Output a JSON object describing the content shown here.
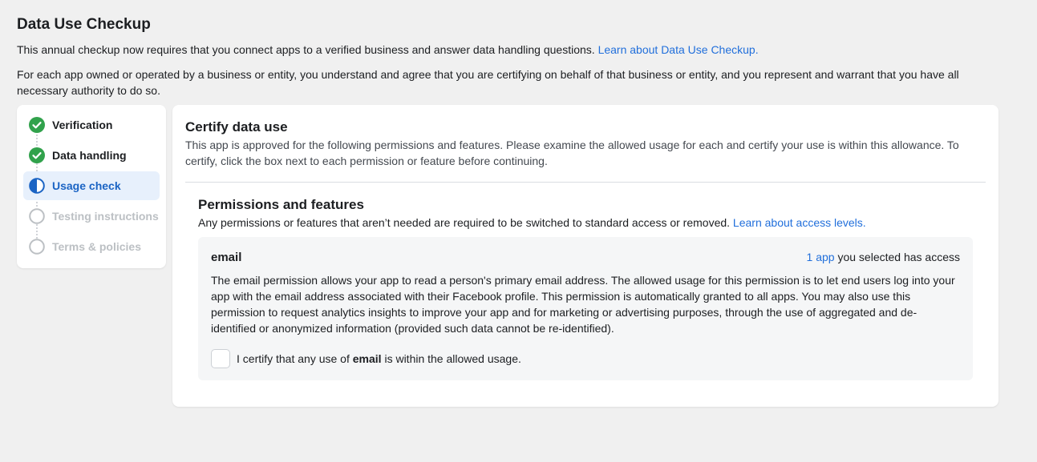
{
  "header": {
    "title": "Data Use Checkup",
    "intro": "This annual checkup now requires that you connect apps to a verified business and answer data handling questions.",
    "intro_link": "Learn about Data Use Checkup.",
    "authority": "For each app owned or operated by a business or entity, you understand and agree that you are certifying on behalf of that business or entity, and you represent and warrant that you have all necessary authority to do so."
  },
  "stepper": {
    "steps": [
      {
        "label": "Verification",
        "state": "done"
      },
      {
        "label": "Data handling",
        "state": "done"
      },
      {
        "label": "Usage check",
        "state": "current"
      },
      {
        "label": "Testing instructions",
        "state": "pending"
      },
      {
        "label": "Terms & policies",
        "state": "pending"
      }
    ]
  },
  "certify": {
    "title": "Certify data use",
    "description": "This app is approved for the following permissions and features. Please examine the allowed usage for each and certify your use is within this allowance. To certify, click the box next to each permission or feature before continuing."
  },
  "permissions": {
    "title": "Permissions and features",
    "description": "Any permissions or features that aren’t needed are required to be switched to standard access or removed.",
    "link": "Learn about access levels.",
    "items": [
      {
        "name": "email",
        "access_link": "1 app",
        "access_text": "you selected has access",
        "description": "The email permission allows your app to read a person's primary email address. The allowed usage for this permission is to let end users log into your app with the email address associated with their Facebook profile. This permission is automatically granted to all apps. You may also use this permission to request analytics insights to improve your app and for marketing or advertising purposes, through the use of aggregated and de-identified or anonymized information (provided such data cannot be re-identified).",
        "certify_prefix": "I certify that any use of",
        "certify_bold": "email",
        "certify_suffix": "is within the allowed usage.",
        "checked": false
      }
    ]
  },
  "colors": {
    "accent": "#216fdb",
    "done_green": "#31a24c",
    "current_blue": "#1b64c4",
    "current_bg": "#e7f0fc",
    "pending_gray": "#bcc0c4"
  },
  "icons": {
    "done": "check-circle-icon",
    "current": "half-circle-icon",
    "pending": "empty-circle-icon"
  }
}
